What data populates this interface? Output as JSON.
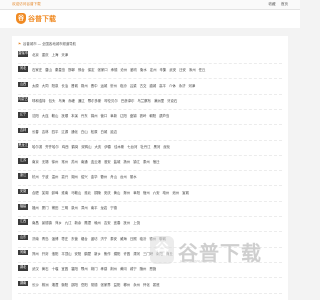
{
  "topbar": {
    "welcome": "欢迎访问谷普下载",
    "links": [
      "收藏",
      "首页"
    ]
  },
  "logo": {
    "mark": "谷",
    "text": "谷普下载"
  },
  "intro": "谷普城市 — 全国各地城市频道导航",
  "provinces": [
    {
      "tag": "直辖市",
      "cities": [
        "北京",
        "重庆",
        "上海",
        "天津"
      ]
    },
    {
      "tag": "河北",
      "cities": [
        "石家庄",
        "唐山",
        "秦皇岛",
        "邯郸",
        "邢台",
        "保定",
        "张家口",
        "承德",
        "沧州",
        "廊坊",
        "衡水",
        "定州",
        "辛集",
        "武安",
        "迁安",
        "涿州",
        "任丘"
      ]
    },
    {
      "tag": "山西",
      "cities": [
        "太原",
        "大同",
        "阳泉",
        "长治",
        "晋城",
        "朔州",
        "晋中",
        "运城",
        "忻州",
        "临汾",
        "吕梁",
        "古交",
        "潞城",
        "高平",
        "介休",
        "永济",
        "河津"
      ]
    },
    {
      "tag": "内蒙古",
      "cities": [
        "呼和浩特",
        "包头",
        "乌海",
        "赤峰",
        "通辽",
        "鄂尔多斯",
        "呼伦贝尔",
        "巴彦淖尔",
        "乌兰察布",
        "满洲里",
        "牙克石"
      ]
    },
    {
      "tag": "辽宁",
      "cities": [
        "沈阳",
        "大连",
        "鞍山",
        "抚顺",
        "本溪",
        "丹东",
        "锦州",
        "营口",
        "阜新",
        "辽阳",
        "盘锦",
        "铁岭",
        "朝阳",
        "葫芦岛"
      ]
    },
    {
      "tag": "吉林",
      "cities": [
        "长春",
        "吉林",
        "四平",
        "辽源",
        "通化",
        "白山",
        "松原",
        "白城",
        "延边"
      ]
    },
    {
      "tag": "黑龙江",
      "cities": [
        "哈尔滨",
        "齐齐哈尔",
        "鸡西",
        "鹤岗",
        "双鸭山",
        "大庆",
        "伊春",
        "佳木斯",
        "七台河",
        "牡丹江",
        "黑河",
        "绥化"
      ]
    },
    {
      "tag": "江苏",
      "cities": [
        "南京",
        "无锡",
        "徐州",
        "常州",
        "苏州",
        "南通",
        "连云港",
        "淮安",
        "盐城",
        "扬州",
        "镇江",
        "泰州",
        "宿迁"
      ]
    },
    {
      "tag": "浙江",
      "cities": [
        "杭州",
        "宁波",
        "温州",
        "嘉兴",
        "湖州",
        "绍兴",
        "金华",
        "衢州",
        "舟山",
        "台州",
        "丽水"
      ]
    },
    {
      "tag": "安徽",
      "cities": [
        "合肥",
        "芜湖",
        "蚌埠",
        "淮南",
        "马鞍山",
        "淮北",
        "铜陵",
        "安庆",
        "黄山",
        "滁州",
        "阜阳",
        "宿州",
        "六安",
        "亳州",
        "池州",
        "宣城"
      ]
    },
    {
      "tag": "福建",
      "cities": [
        "福州",
        "厦门",
        "莆田",
        "三明",
        "泉州",
        "漳州",
        "南平",
        "龙岩",
        "宁德"
      ]
    },
    {
      "tag": "江西",
      "cities": [
        "南昌",
        "景德镇",
        "萍乡",
        "九江",
        "新余",
        "鹰潭",
        "赣州",
        "吉安",
        "宜春",
        "抚州",
        "上饶"
      ]
    },
    {
      "tag": "山东",
      "cities": [
        "济南",
        "青岛",
        "淄博",
        "枣庄",
        "东营",
        "烟台",
        "潍坊",
        "济宁",
        "泰安",
        "威海",
        "日照",
        "临沂",
        "德州",
        "聊城"
      ]
    },
    {
      "tag": "河南",
      "cities": [
        "郑州",
        "开封",
        "洛阳",
        "平顶山",
        "安阳",
        "鹤壁",
        "新乡",
        "焦作",
        "濮阳",
        "许昌",
        "漯河",
        "三门峡",
        "南阳",
        "商丘"
      ]
    },
    {
      "tag": "湖北",
      "cities": [
        "武汉",
        "黄石",
        "十堰",
        "宜昌",
        "襄阳",
        "鄂州",
        "荆门",
        "孝感",
        "荆州",
        "黄冈",
        "咸宁",
        "随州",
        "恩施"
      ]
    },
    {
      "tag": "湖南",
      "cities": [
        "长沙",
        "株洲",
        "湘潭",
        "衡阳",
        "邵阳",
        "岳阳",
        "常德",
        "张家界",
        "益阳",
        "郴州",
        "永州",
        "怀化",
        "娄底"
      ]
    }
  ],
  "watermark": {
    "mark": "谷",
    "text": "谷普下载",
    "sub": "GUPU DOWNLOAD"
  }
}
